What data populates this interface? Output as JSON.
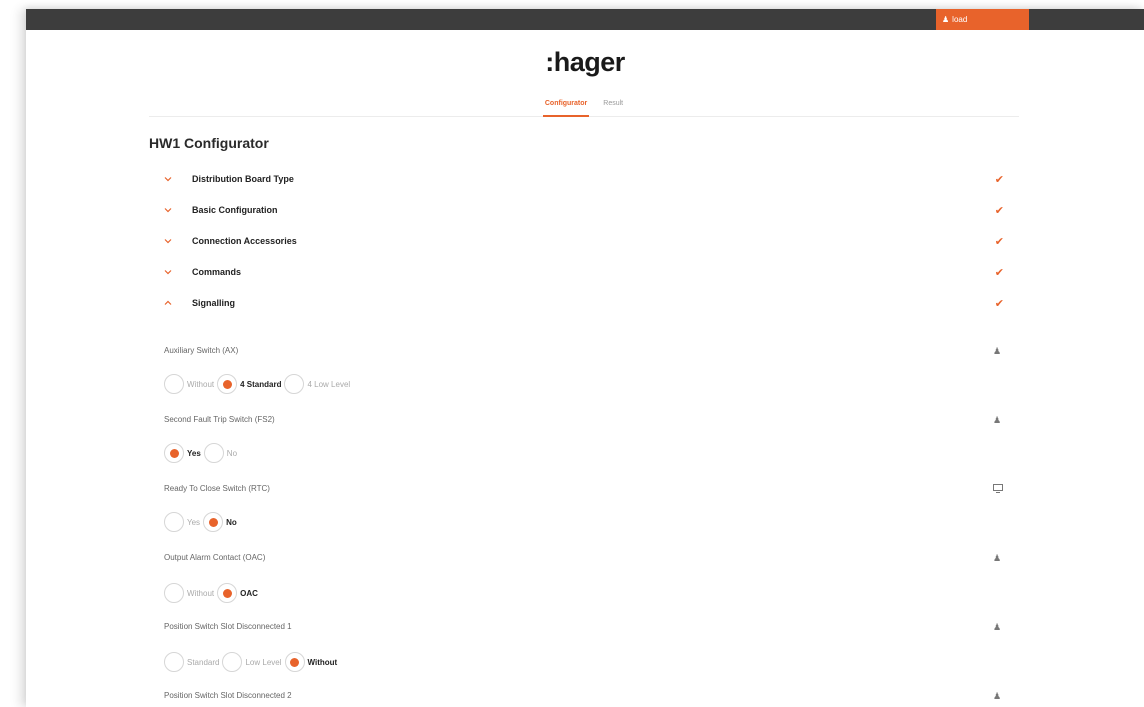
{
  "topbar": {
    "load_label": "load",
    "load_icon": "user-icon",
    "accent": "#e8632b",
    "bar_color": "#3d3d3d"
  },
  "logo": ":hager",
  "tabs": [
    {
      "label": "Configurator",
      "active": true
    },
    {
      "label": "Result",
      "active": false
    }
  ],
  "page_title": "HW1 Configurator",
  "sections": [
    {
      "label": "Distribution Board Type",
      "expanded": false,
      "complete": true
    },
    {
      "label": "Basic Configuration",
      "expanded": false,
      "complete": true
    },
    {
      "label": "Connection Accessories",
      "expanded": false,
      "complete": true
    },
    {
      "label": "Commands",
      "expanded": false,
      "complete": true
    },
    {
      "label": "Signalling",
      "expanded": true,
      "complete": true
    }
  ],
  "options": [
    {
      "label": "Auxiliary Switch (AX)",
      "icon": "user-icon",
      "choices": [
        {
          "label": "Without",
          "selected": false
        },
        {
          "label": "4 Standard",
          "selected": true
        },
        {
          "label": "4 Low Level",
          "selected": false
        }
      ]
    },
    {
      "label": "Second Fault Trip Switch (FS2)",
      "icon": "user-icon",
      "choices": [
        {
          "label": "Yes",
          "selected": true
        },
        {
          "label": "No",
          "selected": false
        }
      ]
    },
    {
      "label": "Ready To Close Switch (RTC)",
      "icon": "monitor-icon",
      "choices": [
        {
          "label": "Yes",
          "selected": false
        },
        {
          "label": "No",
          "selected": true
        }
      ]
    },
    {
      "label": "Output Alarm Contact (OAC)",
      "icon": "user-icon",
      "choices": [
        {
          "label": "Without",
          "selected": false
        },
        {
          "label": "OAC",
          "selected": true
        }
      ]
    },
    {
      "label": "Position Switch Slot Disconnected 1",
      "icon": "user-icon",
      "choices": [
        {
          "label": "Standard",
          "selected": false
        },
        {
          "label": "Low Level",
          "selected": false
        },
        {
          "label": "Without",
          "selected": true
        }
      ]
    },
    {
      "label": "Position Switch Slot Disconnected 2",
      "icon": "user-icon",
      "choices": []
    }
  ]
}
